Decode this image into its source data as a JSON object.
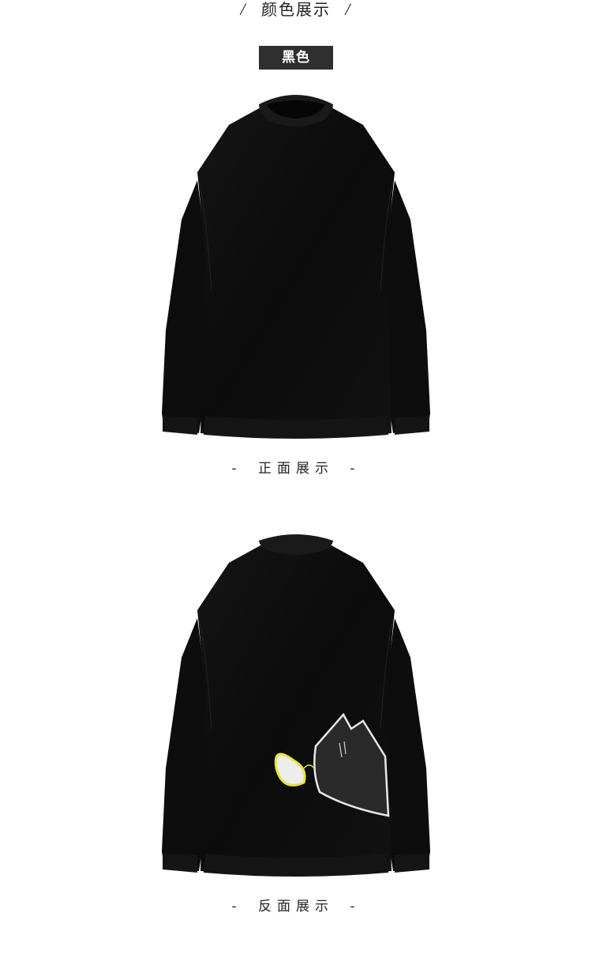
{
  "header": {
    "slash_left": "/",
    "title": "颜色展示",
    "slash_right": "/"
  },
  "color_badge": {
    "label": "黑色",
    "bg_color": "#2f2f2f"
  },
  "front": {
    "caption_dash_left": "-",
    "caption": "正面展示",
    "caption_dash_right": "-"
  },
  "back": {
    "caption_dash_left": "-",
    "caption": "反面展示",
    "caption_dash_right": "-"
  }
}
